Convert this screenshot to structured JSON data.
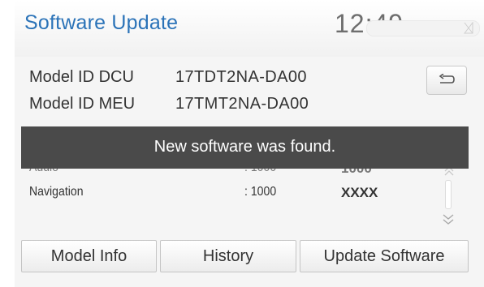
{
  "header": {
    "title": "Software Update",
    "clock": "12:49",
    "status_icon": "no-signal-icon"
  },
  "models": [
    {
      "label": "Model ID DCU",
      "value": "17TDT2NA-DA00"
    },
    {
      "label": "Model ID MEU",
      "value": "17TMT2NA-DA00"
    }
  ],
  "back_button": {
    "icon": "back-arrow-icon"
  },
  "toast": {
    "text": "New software was found."
  },
  "list": {
    "rows": [
      {
        "name": "Audio",
        "version": ": 1000",
        "new_version": "1000"
      },
      {
        "name": "Navigation",
        "version": ": 1000",
        "new_version": "XXXX"
      }
    ],
    "scroll_up_icon": "chevron-double-up-icon",
    "scroll_down_icon": "chevron-double-down-icon"
  },
  "tabs": [
    {
      "label": "Model Info"
    },
    {
      "label": "History"
    },
    {
      "label": "Update Software"
    }
  ],
  "colors": {
    "accent": "#2b73b8",
    "toast_bg": "#4a4a4a",
    "body_bg": "#f5f5f5"
  }
}
